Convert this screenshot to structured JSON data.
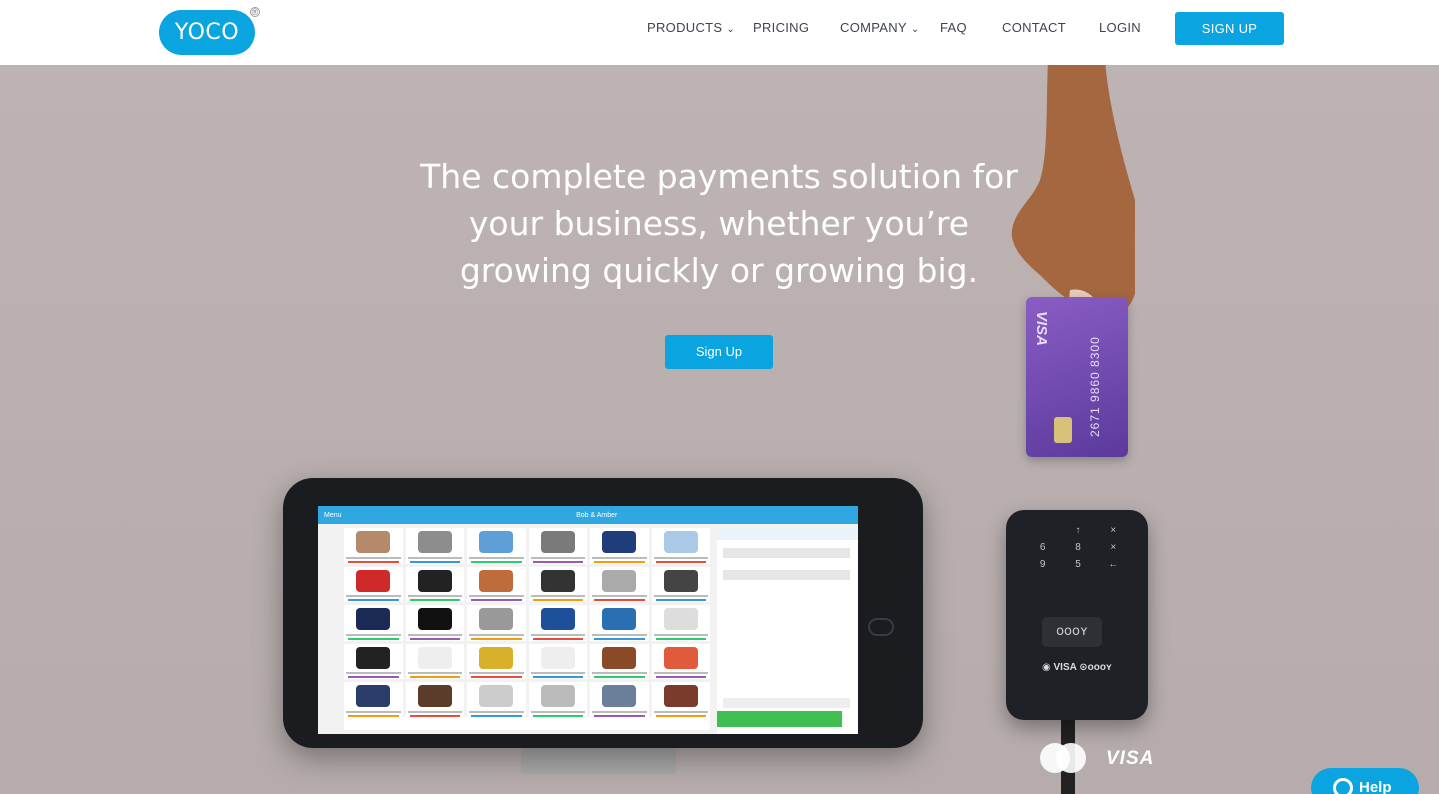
{
  "brand": {
    "logo_text": "YOCO",
    "reg_mark": "®"
  },
  "nav": {
    "products": "PRODUCTS",
    "pricing": "PRICING",
    "company": "COMPANY",
    "faq": "FAQ",
    "contact": "CONTACT",
    "login": "LOGIN",
    "signup": "SIGN UP",
    "chevron": "⌄"
  },
  "hero": {
    "headline_line1": "The complete payments solution for",
    "headline_line2": "your business, whether you’re",
    "headline_line3": "growing quickly or growing big.",
    "cta_label": "Sign Up"
  },
  "device_screen": {
    "menu_label": "Menu",
    "title": "Bob & Amber"
  },
  "card": {
    "brand": "VISA",
    "number": "2671 9860 8300"
  },
  "terminal": {
    "keys": [
      "",
      "↑",
      "×",
      "6",
      "8",
      "×",
      "9",
      "5",
      "←",
      "",
      "",
      ""
    ],
    "logo": "oooʏ",
    "brand_line": "◉ VISA ⊙oooʏ"
  },
  "payment_logos": {
    "mastercard": "mastercard",
    "visa": "VISA"
  },
  "help_widget": {
    "label": "Help"
  },
  "colors": {
    "accent": "#0aa4e0",
    "hero_bg": "#bdb3b3",
    "card": "#6b45ad"
  }
}
